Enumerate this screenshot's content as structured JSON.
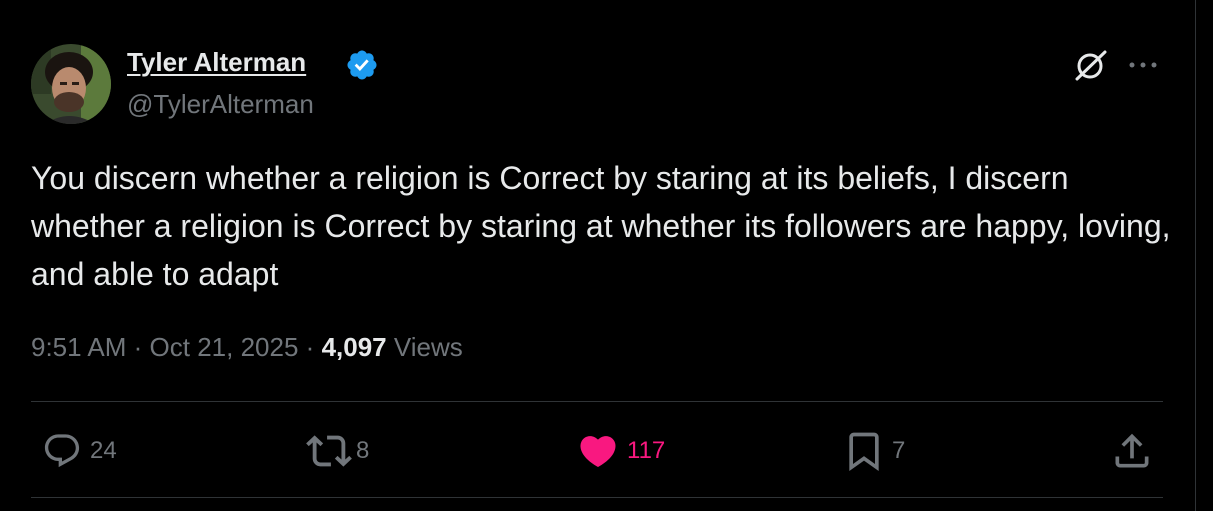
{
  "author": {
    "name": "Tyler Alterman",
    "handle": "@TylerAlterman",
    "verified": true
  },
  "tweet": {
    "text": "You discern whether a religion is Correct by staring at its beliefs, I discern whether a religion is Correct by staring at whether its followers are happy, loving, and able to adapt",
    "time": "9:51 AM",
    "date": "Oct 21, 2025",
    "views_count": "4,097",
    "views_label": "Views",
    "separator": "·"
  },
  "actions": {
    "replies": "24",
    "reposts": "8",
    "likes": "117",
    "bookmarks": "7"
  },
  "icons": {
    "header": [
      "grok-icon",
      "more-icon"
    ],
    "actions": [
      "reply-icon",
      "repost-icon",
      "heart-icon",
      "bookmark-icon",
      "share-icon"
    ]
  },
  "colors": {
    "background": "#000000",
    "text": "#e7e9ea",
    "secondary": "#71767b",
    "verified": "#1d9bf0",
    "like": "#f91880",
    "divider": "#2f3336"
  }
}
